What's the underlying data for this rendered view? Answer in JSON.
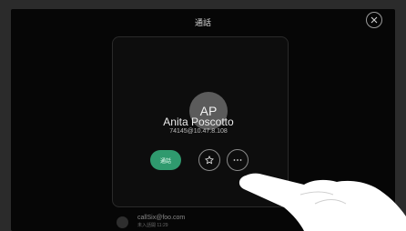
{
  "header": {
    "title": "通話"
  },
  "contact": {
    "initials": "AP",
    "name": "Anita Poscotto",
    "address": "74145@10.47.8.108"
  },
  "actions": {
    "call_label": "通話",
    "favorite_icon": "star-icon",
    "more_icon": "more-icon"
  },
  "recent": {
    "address": "callSix@foo.com",
    "detail": "未入話開 11:29"
  },
  "colors": {
    "call_button": "#2f9a6e",
    "background": "#060606",
    "avatar": "#5b5b5b"
  }
}
